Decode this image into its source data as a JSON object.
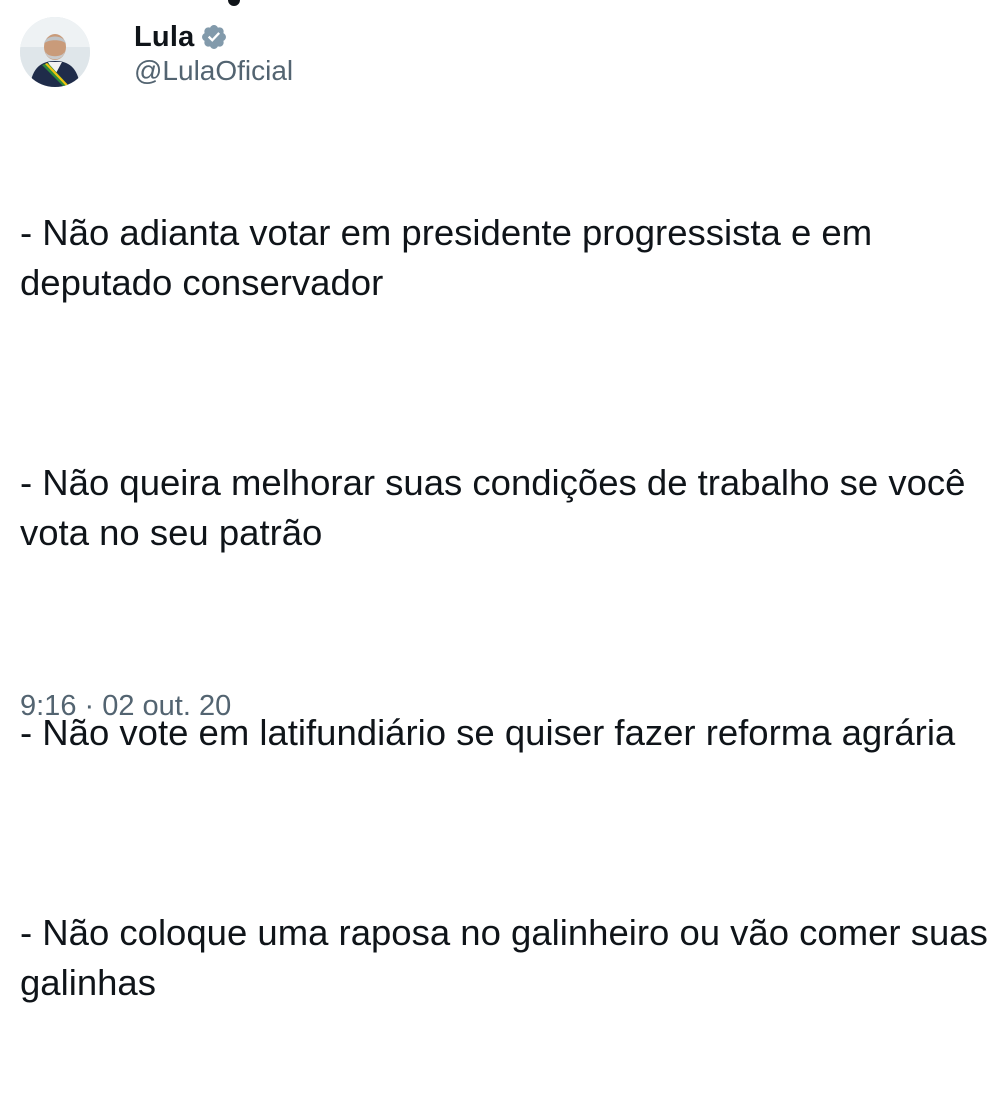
{
  "author": {
    "display_name": "Lula",
    "handle": "@LulaOficial",
    "avatar_icon": "profile-photo-avatar",
    "verified_icon": "verified-badge-icon",
    "verified_color": "#829aab"
  },
  "tweet": {
    "paragraphs": [
      "- Não adianta votar em presidente progressista e em deputado conservador",
      "- Não queira melhorar suas condições de trabalho se você vota no seu patrão",
      "- Não vote em latifundiário se quiser fazer reforma agrária",
      "- Não coloque uma raposa no galinheiro ou vão comer suas galinhas"
    ],
    "timestamp": "9:16 · 02 out. 20"
  },
  "colors": {
    "text": "#0f1419",
    "secondary": "#536471",
    "background": "#ffffff"
  }
}
